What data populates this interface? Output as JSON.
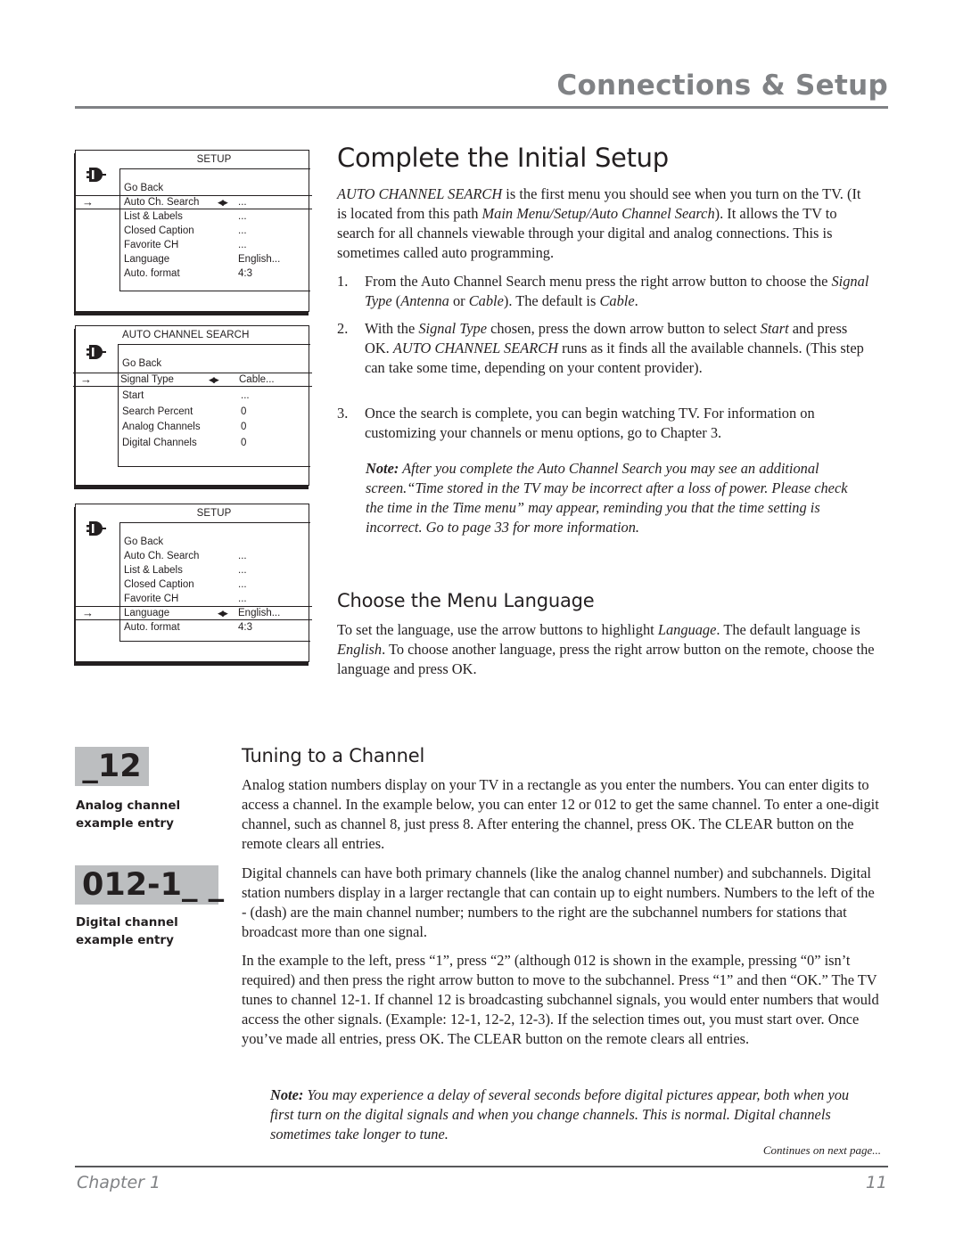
{
  "header": {
    "title": "Connections & Setup"
  },
  "menus": [
    {
      "title": "SETUP",
      "rows": [
        {
          "label": "Go Back",
          "value": ""
        },
        {
          "label": "Auto Ch. Search",
          "value": "...",
          "selected": true
        },
        {
          "label": "List & Labels",
          "value": "..."
        },
        {
          "label": "Closed Caption",
          "value": "..."
        },
        {
          "label": "Favorite CH",
          "value": "..."
        },
        {
          "label": "Language",
          "value": "English..."
        },
        {
          "label": "Auto. format",
          "value": "4:3"
        }
      ]
    },
    {
      "title": "AUTO CHANNEL SEARCH",
      "rows": [
        {
          "label": "Go Back",
          "value": ""
        },
        {
          "label": "Signal Type",
          "value": "Cable...",
          "selected": true
        },
        {
          "label": "Start",
          "value": "..."
        },
        {
          "label": "Search Percent",
          "value": "0"
        },
        {
          "label": "Analog Channels",
          "value": "0"
        },
        {
          "label": "Digital Channels",
          "value": "0"
        }
      ]
    },
    {
      "title": "SETUP",
      "rows": [
        {
          "label": "Go Back",
          "value": ""
        },
        {
          "label": "Auto Ch. Search",
          "value": "..."
        },
        {
          "label": "List & Labels",
          "value": "..."
        },
        {
          "label": "Closed Caption",
          "value": "..."
        },
        {
          "label": "Favorite CH",
          "value": "..."
        },
        {
          "label": "Language",
          "value": "English...",
          "selected": true
        },
        {
          "label": "Auto. format",
          "value": "4:3"
        }
      ]
    }
  ],
  "menu_icons": {
    "logo": "tv-plug-icon",
    "pointer": "→",
    "leftright": "◀▶"
  },
  "section1": {
    "heading": "Complete the Initial Setup",
    "intro_em1": "AUTO CHANNEL SEARCH",
    "intro_t1": " is the first menu you should see when you turn on the TV. (It is located from this path ",
    "intro_em2": "Main Menu/Setup/Auto Channel Search",
    "intro_t2": "). It allows the TV to search for all channels viewable through your digital and analog connections. This is sometimes called auto programming.",
    "steps": [
      {
        "num": "1.",
        "t1": "From the Auto Channel Search menu press the right arrow button to choose the ",
        "e1": "Signal Type",
        "t2": " (",
        "e2": "Antenna",
        "t3": " or ",
        "e3": "Cable",
        "t4": "). The default is ",
        "e4": "Cable",
        "t5": "."
      },
      {
        "num": "2.",
        "t1": "With the ",
        "e1": "Signal Type",
        "t2": " chosen, press the down arrow button to select ",
        "e2": "Start",
        "t3": " and press OK. ",
        "e3": "AUTO CHANNEL SEARCH",
        "t4": " runs as it finds all the available channels. (This step can take some time, depending on your content provider)."
      },
      {
        "num": "3.",
        "t1": "Once the search is complete, you can begin watching TV. For information on customizing your channels or menu options, go to Chapter 3."
      }
    ],
    "note_label": "Note:",
    "note_text": " After you complete the Auto Channel Search you may see an additional screen.“Time stored in the TV may be incorrect after a loss of power. Please check the time in the Time menu” may appear, reminding you that the time setting is incorrect. Go to page 33 for more information."
  },
  "section2": {
    "heading": "Choose the Menu Language",
    "t1": "To set the language, use the arrow buttons to highlight ",
    "e1": "Language",
    "t2": ". The default language is ",
    "e2": "English",
    "t3": ". To choose another language, press the right arrow button on the remote, choose the language and press OK."
  },
  "section3": {
    "heading": "Tuning to a Channel",
    "p1": "Analog station numbers display on your TV in a rectangle as you enter the numbers. You can enter digits to access a channel. In the example below, you can enter 12 or 012 to get the same channel. To enter a one-digit channel, such as channel 8, just press 8. After entering the channel, press OK. The CLEAR button on the remote clears all entries.",
    "p2": "Digital channels can have both primary channels (like the analog channel number) and subchannels. Digital station numbers display in a larger rectangle that can contain up to eight numbers. Numbers to the left of the - (dash) are the main channel number; numbers to the right are the subchannel numbers for stations that broadcast more than one signal.",
    "p3": "In the example to the left, press “1”, press “2” (although 012 is shown in the example, pressing “0” isn’t required) and then press the right arrow button to move to the subchannel. Press “1” and then “OK.” The TV tunes to channel 12-1. If channel 12 is broadcasting subchannel signals, you would enter numbers that would access the other signals. (Example: 12-1, 12-2, 12-3). If the selection times out, you must start over. Once you’ve made all entries, press OK. The CLEAR button on the remote clears all entries.",
    "note_label": "Note:",
    "note_text": " You may experience a delay of several seconds before digital pictures appear, both when you first turn on the digital signals and when you change channels. This is normal. Digital channels sometimes take longer to tune.",
    "continues": "Continues on next page..."
  },
  "examples": {
    "analog_value": "_12",
    "analog_caption": "Analog channel example entry",
    "digital_value": "012-1_ _",
    "digital_caption": "Digital channel example entry"
  },
  "footer": {
    "chapter": "Chapter 1",
    "page": "11"
  }
}
